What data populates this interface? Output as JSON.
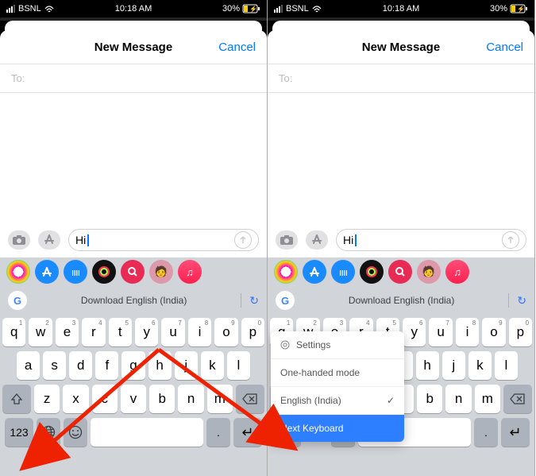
{
  "status": {
    "carrier": "BSNL",
    "time": "10:18 AM",
    "battery_pct": "30%"
  },
  "sheet": {
    "title": "New Message",
    "cancel": "Cancel",
    "to_label": "To:"
  },
  "input": {
    "value": "Hi"
  },
  "suggestion_bar": {
    "download_label": "Download English (India)"
  },
  "keyboard": {
    "row1": [
      {
        "k": "q",
        "n": "1"
      },
      {
        "k": "w",
        "n": "2"
      },
      {
        "k": "e",
        "n": "3"
      },
      {
        "k": "r",
        "n": "4"
      },
      {
        "k": "t",
        "n": "5"
      },
      {
        "k": "y",
        "n": "6"
      },
      {
        "k": "u",
        "n": "7"
      },
      {
        "k": "i",
        "n": "8"
      },
      {
        "k": "o",
        "n": "9"
      },
      {
        "k": "p",
        "n": "0"
      }
    ],
    "row2": [
      "a",
      "s",
      "d",
      "f",
      "g",
      "h",
      "j",
      "k",
      "l"
    ],
    "row3": [
      "z",
      "x",
      "c",
      "v",
      "b",
      "n",
      "m"
    ],
    "numkey": "123",
    "period": ".",
    "return_glyph": "↵"
  },
  "popup": {
    "settings": "Settings",
    "one_hand": "One-handed mode",
    "lang": "English (India)",
    "next": "Next Keyboard"
  },
  "icons": {
    "camera": "camera",
    "appstore": "A",
    "waves": "||||",
    "google_g": "G",
    "refresh": "↻",
    "globe": "globe",
    "smile": "☺",
    "search": "🔍",
    "music": "♫",
    "gear": "⚙",
    "check": "✓"
  },
  "colors": {
    "accent": "#007aff",
    "popup_selected": "#2e7fff"
  }
}
